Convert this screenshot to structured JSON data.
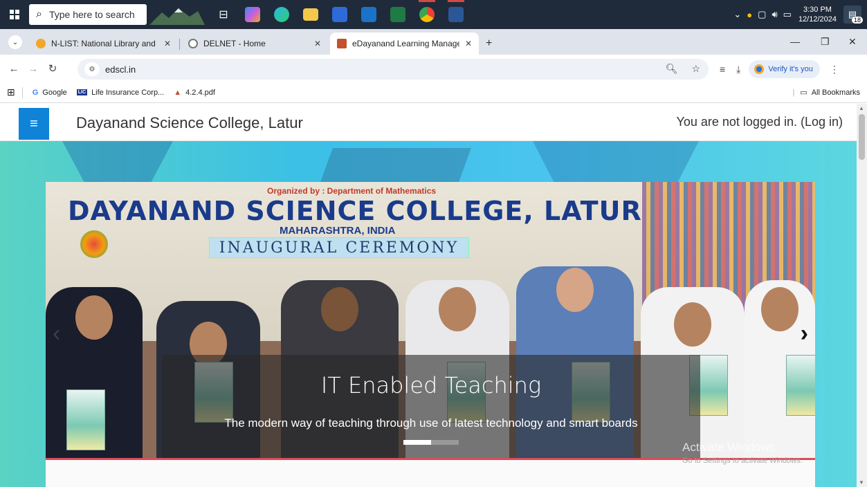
{
  "taskbar": {
    "search_placeholder": "Type here to search",
    "time": "3:30 PM",
    "date": "12/12/2024",
    "notification_count": "18"
  },
  "tabs": [
    {
      "title": "N-LIST: National Library and Inf",
      "color": "#f4a62a"
    },
    {
      "title": "DELNET - Home",
      "color": "#888888"
    },
    {
      "title": "eDayanand Learning Manageme",
      "color": "#c4502c"
    }
  ],
  "address": {
    "url": "edscl.in",
    "verify_label": "Verify it's you"
  },
  "bookmarks": {
    "items": [
      {
        "label": "Google",
        "icon": "G"
      },
      {
        "label": "Life Insurance Corp...",
        "icon": "LIC"
      },
      {
        "label": "4.2.4.pdf",
        "icon": "pdf"
      }
    ],
    "all_label": "All Bookmarks"
  },
  "site": {
    "title": "Dayanand Science College, Latur",
    "login_text": "You are not logged in. (Log in)"
  },
  "banner": {
    "organized": "Organized by : Department of Mathematics",
    "heading": "DAYANAND SCIENCE COLLEGE, LATUR",
    "subheading": "MAHARASHTRA, INDIA",
    "ceremony": "INAUGURAL CEREMONY"
  },
  "carousel": {
    "caption_title": "IT Enabled Teaching",
    "caption_text": "The modern way of teaching through use of latest technology and smart boards",
    "active_index": 0,
    "count": 2
  },
  "watermark": {
    "line1": "Activate Windows",
    "line2": "Go to Settings to activate Windows."
  },
  "colors": {
    "taskbar": "#1f2b3a",
    "accent": "#0f83d8",
    "hero_gradient": "#3bc0e6"
  }
}
